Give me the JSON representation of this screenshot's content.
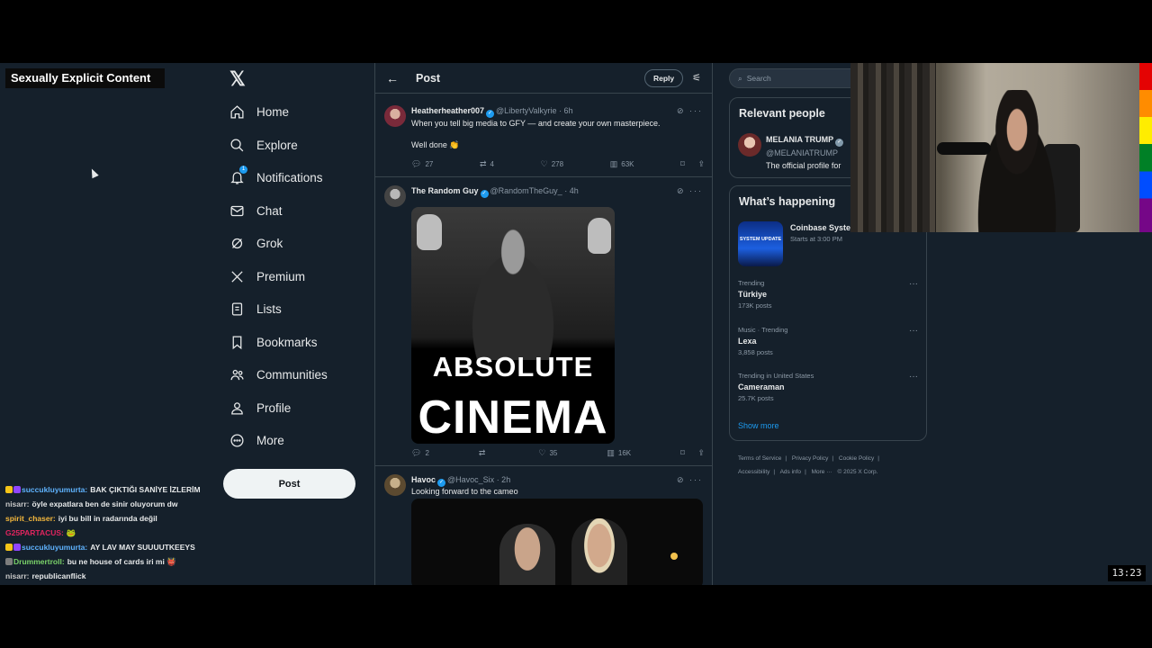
{
  "overlay": {
    "explicit_label": "Sexually Explicit Content"
  },
  "nav": {
    "items": [
      {
        "label": "Home",
        "icon": "home-icon"
      },
      {
        "label": "Explore",
        "icon": "search-icon"
      },
      {
        "label": "Notifications",
        "icon": "bell-icon",
        "badge": "1"
      },
      {
        "label": "Chat",
        "icon": "mail-icon"
      },
      {
        "label": "Grok",
        "icon": "grok-icon"
      },
      {
        "label": "Premium",
        "icon": "x-logo-icon"
      },
      {
        "label": "Lists",
        "icon": "list-icon"
      },
      {
        "label": "Bookmarks",
        "icon": "bookmark-icon"
      },
      {
        "label": "Communities",
        "icon": "people-icon"
      },
      {
        "label": "Profile",
        "icon": "person-icon"
      },
      {
        "label": "More",
        "icon": "more-circle-icon"
      }
    ],
    "post_label": "Post"
  },
  "header": {
    "title": "Post",
    "reply_label": "Reply"
  },
  "tweets": [
    {
      "name": "Heatherheather007",
      "handle": "@LibertyValkyrie",
      "time": "· 6h",
      "text": "When you tell big media to GFY — and create your own masterpiece.\n\nWell done 👏",
      "replies": "27",
      "reposts": "4",
      "likes": "278",
      "views": "63K"
    },
    {
      "name": "The Random Guy",
      "handle": "@RandomTheGuy_",
      "time": "· 4h",
      "image_text_top": "ABSOLUTE",
      "image_text_bottom": "CINEMA",
      "replies": "2",
      "reposts": "",
      "likes": "35",
      "views": "16K"
    },
    {
      "name": "Havoc",
      "handle": "@Havoc_Six",
      "time": "· 2h",
      "text": "Looking forward to the cameo"
    }
  ],
  "right": {
    "search_placeholder": "Search",
    "relevant_title": "Relevant people",
    "relevant": {
      "name": "MELANIA TRUMP",
      "handle": "@MELANIATRUMP",
      "bio": "The official profile for"
    },
    "happening_title": "What’s happening",
    "event": {
      "title": "Coinbase Syste",
      "subtitle": "Starts at 3:00 PM",
      "image_text": "SYSTEM UPDATE"
    },
    "trends": [
      {
        "context": "Trending",
        "name": "Türkiye",
        "count": "173K posts"
      },
      {
        "context": "Music · Trending",
        "name": "Lexa",
        "count": "3,858 posts"
      },
      {
        "context": "Trending in United States",
        "name": "Cameraman",
        "count": "25.7K posts"
      }
    ],
    "show_more": "Show more",
    "footer": [
      "Terms of Service",
      "|",
      "Privacy Policy",
      "|",
      "Cookie Policy",
      "|",
      "Accessibility",
      "|",
      "Ads info",
      "|",
      "More ···",
      "© 2025 X Corp."
    ]
  },
  "chat": [
    {
      "user": "succukluyumurta:",
      "msg": "BAK ÇIKTIĞI SANİYE İZLERİM",
      "color": "#5fb3ff",
      "badges": true
    },
    {
      "user": "nisarr:",
      "msg": "öyle expatlara ben de sinir oluyorum dw",
      "color": "#c9c9c9",
      "badges": false
    },
    {
      "user": "spirit_chaser:",
      "msg": "iyi bu bill in radarında değil",
      "color": "#f5b83d",
      "badges": false
    },
    {
      "user": "G25PARTACUS:",
      "msg": "🐸",
      "color": "#e0245e",
      "badges": false
    },
    {
      "user": "succukluyumurta:",
      "msg": "AY LAV MAY SUUUUTKEEYS",
      "color": "#5fb3ff",
      "badges": true
    },
    {
      "user": "Drummertroll:",
      "msg": "bu ne house of cards iri mi 👹",
      "color": "#7bd36a",
      "badges": true
    },
    {
      "user": "nisarr:",
      "msg": "republicanflick",
      "color": "#c9c9c9",
      "badges": false
    }
  ],
  "clock": "13:23"
}
